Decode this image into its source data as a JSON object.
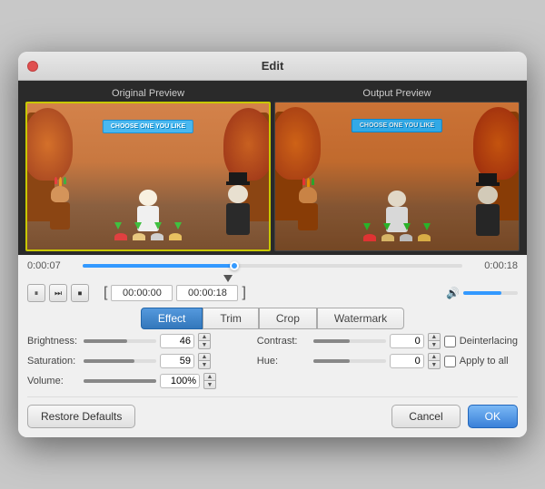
{
  "window": {
    "title": "Edit"
  },
  "preview": {
    "original_label": "Original Preview",
    "output_label": "Output Preview",
    "banner_text": "CHOOSE ONE YOU LIKE"
  },
  "timeline": {
    "start_time": "0:00:07",
    "end_time": "0:00:18"
  },
  "playback": {
    "pause_icon": "⏸",
    "step_forward_icon": "⏭",
    "stop_icon": "⏹",
    "range_start": "00:00:00",
    "range_end": "00:00:18"
  },
  "tabs": [
    {
      "id": "effect",
      "label": "Effect",
      "active": true
    },
    {
      "id": "trim",
      "label": "Trim",
      "active": false
    },
    {
      "id": "crop",
      "label": "Crop",
      "active": false
    },
    {
      "id": "watermark",
      "label": "Watermark",
      "active": false
    }
  ],
  "params": {
    "brightness_label": "Brightness:",
    "brightness_value": "46",
    "contrast_label": "Contrast:",
    "contrast_value": "0",
    "saturation_label": "Saturation:",
    "saturation_value": "59",
    "hue_label": "Hue:",
    "hue_value": "0",
    "volume_label": "Volume:",
    "volume_value": "100%",
    "deinterlacing_label": "Deinterlacing",
    "apply_all_label": "Apply to all"
  },
  "buttons": {
    "restore_label": "Restore Defaults",
    "cancel_label": "Cancel",
    "ok_label": "OK"
  }
}
